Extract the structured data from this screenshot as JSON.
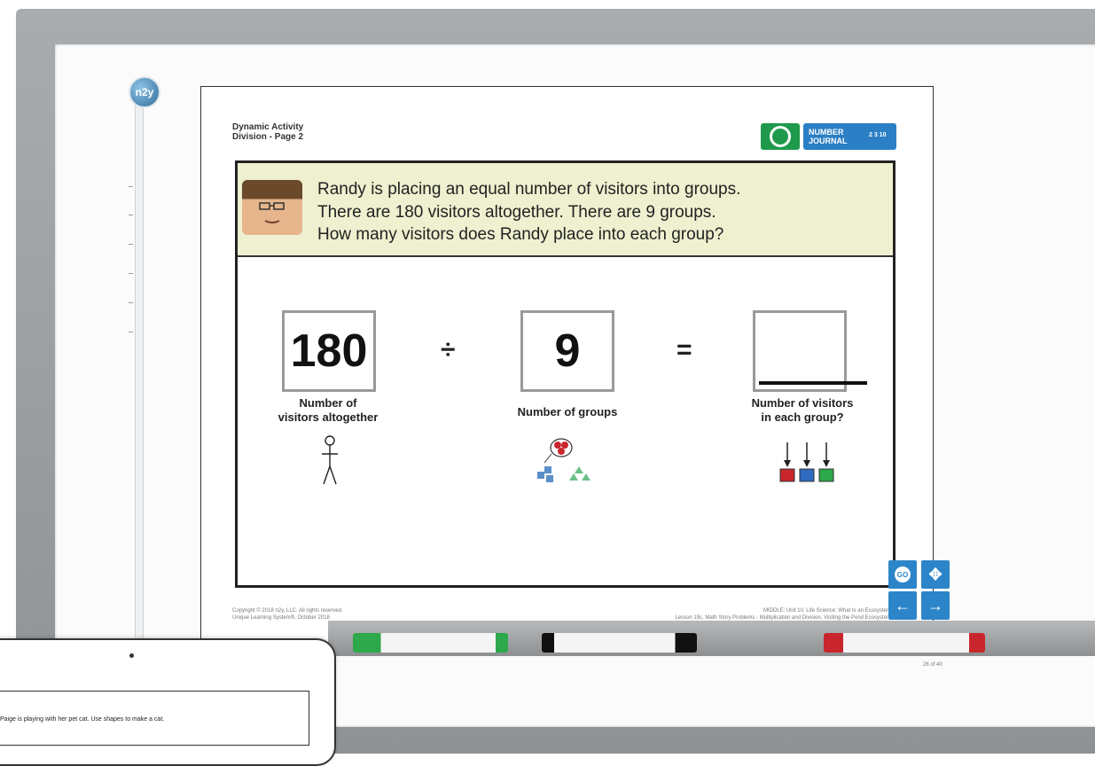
{
  "app": {
    "logo_text": "n2y"
  },
  "page": {
    "title_line1": "Dynamic Activity",
    "title_line2": "Division - Page 2",
    "journal_label_line1": "NUMBER",
    "journal_label_line2": "JOURNAL",
    "journal_numbers": "2 3 10"
  },
  "story": {
    "lines": [
      "Randy is placing an equal number of visitors into groups.",
      "There are 180 visitors altogether.  There are 9 groups.",
      "How many visitors does Randy place into each group?"
    ]
  },
  "equation": {
    "dividend": "180",
    "divide_symbol": "÷",
    "divisor": "9",
    "equals_symbol": "=",
    "dividend_caption_line1": "Number of",
    "dividend_caption_line2": "visitors altogether",
    "divisor_caption": "Number of groups",
    "answer_caption_line1": "Number of visitors",
    "answer_caption_line2": "in each group?"
  },
  "footer": {
    "left_line1": "Copyright © 2018 n2y, LLC. All rights reserved.",
    "left_line2": "Unique Learning System®, October 2018",
    "right_line1": "MIDDLE: Unit 10, Life Science: What Is an Ecosystem",
    "right_line2": "Lesson 19c, Math Story Problems - Multiplication and Division, Visiting the Pond Ecosystem",
    "page_counter": "26 of 40"
  },
  "nav": {
    "go_label": "GO",
    "move_icon": "✥",
    "prev_icon": "←",
    "next_icon": "→",
    "speech_icon": "🗩"
  },
  "tablet": {
    "text": "Paige is playing with her pet cat.  Use shapes to make a cat."
  },
  "colors": {
    "story_bg": "#eef0cf",
    "refresh_green": "#1f9a4d",
    "nav_blue": "#2c85c9",
    "marker_green": "#2da84a",
    "marker_black": "#111111",
    "marker_red": "#c8262c"
  }
}
